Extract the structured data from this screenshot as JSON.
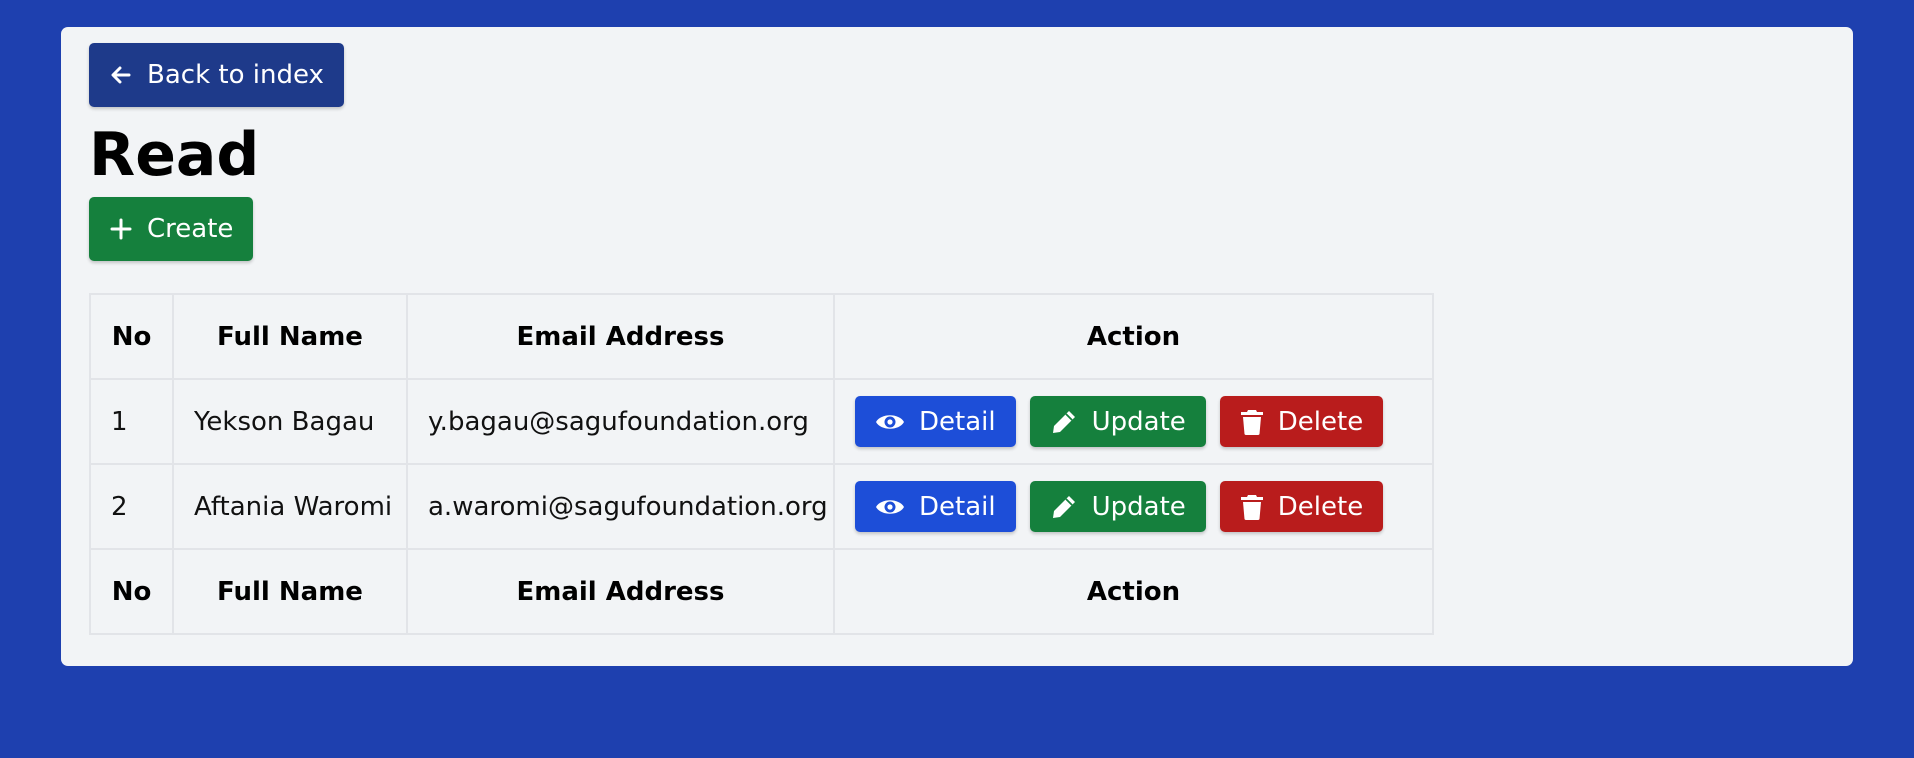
{
  "nav": {
    "back_label": "Back to index"
  },
  "page": {
    "title": "Read",
    "create_label": "Create"
  },
  "table": {
    "headers": {
      "no": "No",
      "name": "Full Name",
      "email": "Email Address",
      "action": "Action"
    },
    "rows": [
      {
        "no": "1",
        "name": "Yekson Bagau",
        "email": "y.bagau@sagufoundation.org"
      },
      {
        "no": "2",
        "name": "Aftania Waromi",
        "email": "a.waromi@sagufoundation.org"
      }
    ],
    "actions": {
      "detail": "Detail",
      "update": "Update",
      "delete": "Delete"
    }
  },
  "icons": {
    "back": "arrow-left-icon",
    "create": "plus-icon",
    "detail": "eye-icon",
    "update": "pencil-icon",
    "delete": "trash-icon"
  },
  "colors": {
    "background": "#1e40af",
    "card": "#f2f4f6",
    "back_button": "#1e3a8a",
    "create_button": "#15803d",
    "detail_button": "#1d4ed8",
    "update_button": "#15803d",
    "delete_button": "#b91c1c"
  }
}
